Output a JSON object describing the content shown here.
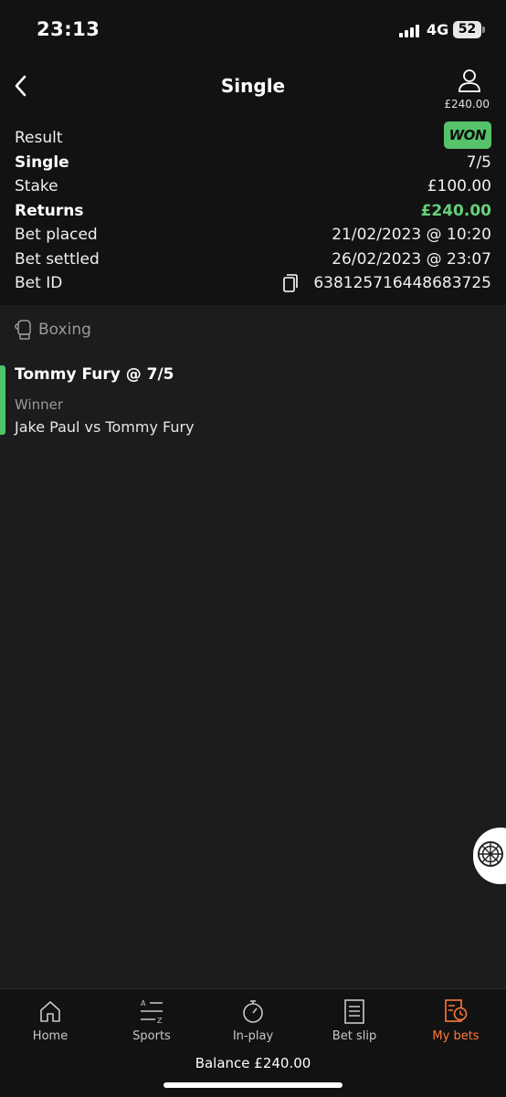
{
  "status_bar": {
    "time": "23:13",
    "network": "4G",
    "battery": "52"
  },
  "header": {
    "title": "Single",
    "account_balance": "£240.00"
  },
  "summary": {
    "result_label": "Result",
    "result_badge": "WON",
    "bet_type_label": "Single",
    "odds": "7/5",
    "stake_label": "Stake",
    "stake_value": "£100.00",
    "returns_label": "Returns",
    "returns_value": "£240.00",
    "placed_label": "Bet placed",
    "placed_value": "21/02/2023 @ 10:20",
    "settled_label": "Bet settled",
    "settled_value": "26/02/2023 @ 23:07",
    "betid_label": "Bet ID",
    "betid_value": "638125716448683725"
  },
  "sport": {
    "name": "Boxing"
  },
  "selection": {
    "title": "Tommy Fury @ 7/5",
    "market": "Winner",
    "event": "Jake Paul vs Tommy Fury"
  },
  "nav": {
    "items": [
      {
        "label": "Home",
        "icon": "home-icon"
      },
      {
        "label": "Sports",
        "icon": "sports-az-icon"
      },
      {
        "label": "In-play",
        "icon": "stopwatch-icon"
      },
      {
        "label": "Bet slip",
        "icon": "betslip-icon"
      },
      {
        "label": "My bets",
        "icon": "mybets-icon"
      }
    ],
    "active": "My bets",
    "balance": "Balance £240.00"
  },
  "colors": {
    "accent_green": "#56c26a",
    "accent_orange": "#ff7a3d",
    "background": "#1c1c1c",
    "header_bg": "#121212"
  }
}
